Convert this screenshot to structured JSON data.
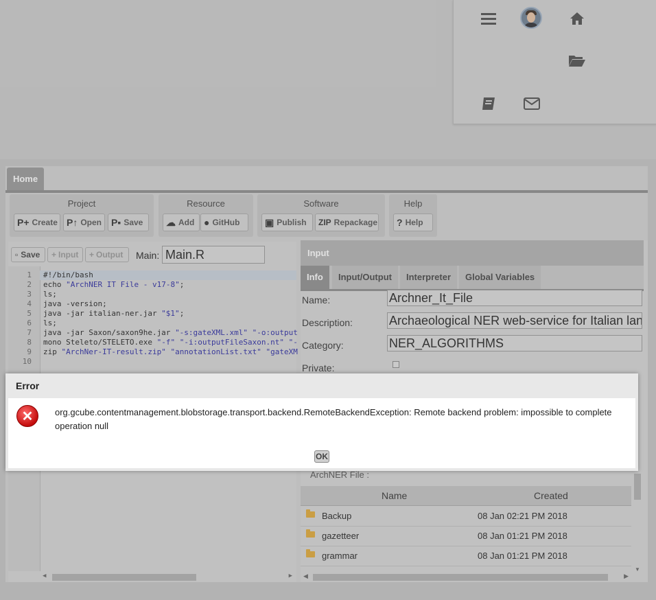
{
  "user_menu": {
    "icons": [
      "menu-icon",
      "avatar",
      "home-icon",
      "folder-open-icon",
      "book-icon",
      "mail-icon"
    ]
  },
  "tabs": {
    "home": "Home"
  },
  "ribbon": {
    "project": {
      "title": "Project",
      "create": "Create",
      "open": "Open",
      "save": "Save"
    },
    "resource": {
      "title": "Resource",
      "add": "Add",
      "github": "GitHub"
    },
    "software": {
      "title": "Software",
      "publish": "Publish",
      "repackage": "Repackage",
      "zip_glyph": "ZIP"
    },
    "help": {
      "title": "Help",
      "help": "Help"
    }
  },
  "editor": {
    "save": "Save",
    "input": "Input",
    "output": "Output",
    "main_label": "Main:",
    "main_value": "Main.R",
    "lines": [
      {
        "n": "1",
        "code": "#!/bin/bash"
      },
      {
        "n": "2",
        "code": "echo \"ArchNER IT File - v17-8\";"
      },
      {
        "n": "3",
        "code": "ls;"
      },
      {
        "n": "4",
        "code": "java -version;"
      },
      {
        "n": "5",
        "code": "java -jar italian-ner.jar \"$1\";"
      },
      {
        "n": "6",
        "code": "ls;"
      },
      {
        "n": "7",
        "code": "java -jar Saxon/saxon9he.jar \"-s:gateXML.xml\" \"-o:output"
      },
      {
        "n": "8",
        "code": "mono Steleto/STELETO.exe \"-f\" \"-i:outputFileSaxon.nt\" \"-"
      },
      {
        "n": "9",
        "code": "zip \"ArchNer-IT-result.zip\" \"annotationList.txt\" \"gateXM"
      },
      {
        "n": "10",
        "code": ""
      }
    ]
  },
  "info_panel": {
    "header": "Input",
    "tabs": [
      "Info",
      "Input/Output",
      "Interpreter",
      "Global Variables"
    ],
    "name_label": "Name:",
    "name_value": "Archner_It_File",
    "description_label": "Description:",
    "description_value": "Archaeological NER web-service for Italian lan",
    "category_label": "Category:",
    "category_value": "NER_ALGORITHMS",
    "private_label": "Private:"
  },
  "workspace": {
    "title": "ArchNER File :",
    "columns": [
      "Name",
      "Created"
    ],
    "rows": [
      {
        "name": "Backup",
        "created": "08 Jan 02:21 PM 2018"
      },
      {
        "name": "gazetteer",
        "created": "08 Jan 01:21 PM 2018"
      },
      {
        "name": "grammar",
        "created": "08 Jan 01:21 PM 2018"
      }
    ]
  },
  "dialog": {
    "title": "Error",
    "message": "org.gcube.contentmanagement.blobstorage.transport.backend.RemoteBackendException: Remote backend problem: impossible to complete operation null",
    "ok": "OK"
  }
}
